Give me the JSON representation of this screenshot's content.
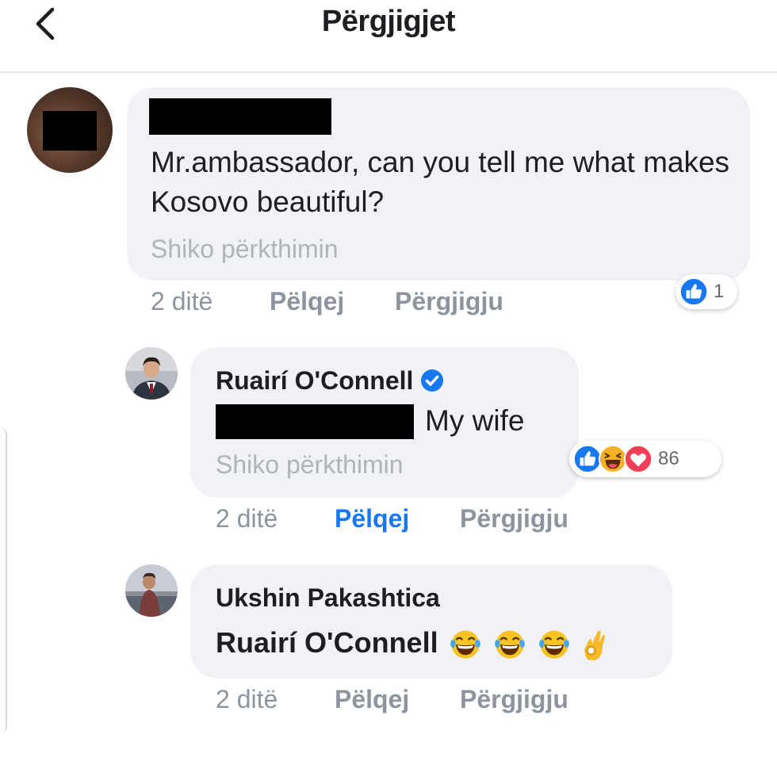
{
  "header": {
    "title": "Përgjigjet"
  },
  "comments": [
    {
      "text": "Mr.ambassador, can you tell me what makes Kosovo beautiful?",
      "translate": "Shiko përkthimin",
      "time": "2 ditë",
      "like": "Pëlqej",
      "reply": "Përgjigju",
      "reaction_count": "1",
      "reactions": [
        "like-icon"
      ]
    },
    {
      "author": "Ruairí O'Connell",
      "verified": true,
      "text": "My wife",
      "translate": "Shiko përkthimin",
      "time": "2 ditë",
      "like": "Pëlqej",
      "like_active": true,
      "reply": "Përgjigju",
      "reaction_count": "86",
      "reactions": [
        "like-icon",
        "haha-icon",
        "love-icon"
      ]
    },
    {
      "author": "Ukshin Pakashtica",
      "text": "Ruairí O'Connell",
      "emojis": [
        "laughing-tears-emoji",
        "laughing-tears-emoji",
        "laughing-tears-emoji",
        "ok-hand-emoji"
      ],
      "time": "2 ditë",
      "like": "Pëlqej",
      "reply": "Përgjigju"
    }
  ],
  "colors": {
    "accent": "#1877f2",
    "bubble": "#f0f2f5",
    "muted": "#8d949e",
    "love": "#f33e58",
    "haha": "#f7b125"
  }
}
